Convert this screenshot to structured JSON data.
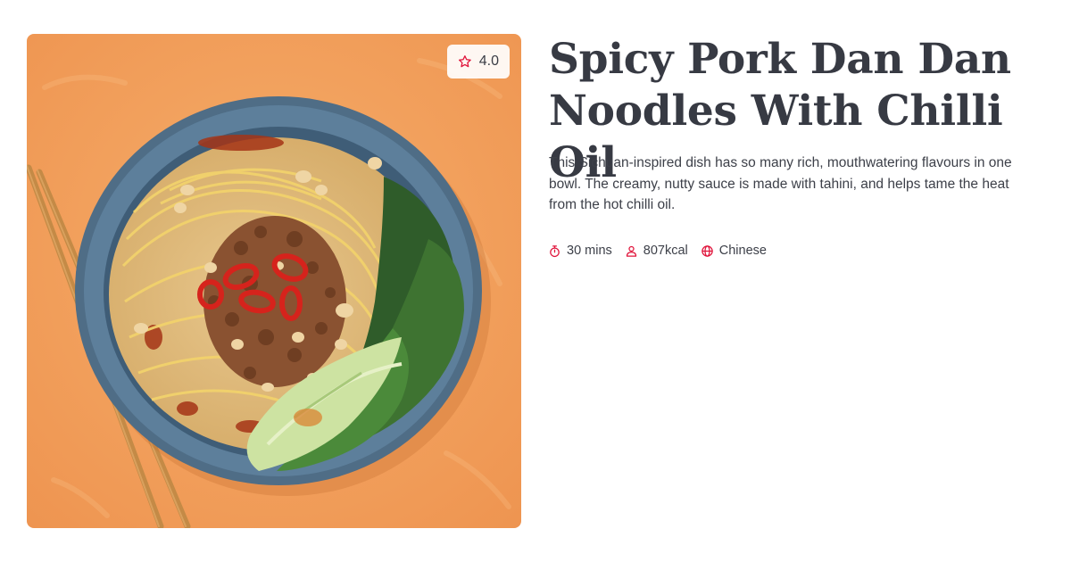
{
  "recipe": {
    "title": "Spicy Pork Dan Dan Noodles With Chilli Oil",
    "description": "This Sichuan-inspired dish has so many rich, mouthwatering flavours in one bowl. The creamy, nutty sauce is made with tahini, and helps tame the heat from the hot chilli oil.",
    "rating": "4.0",
    "meta": {
      "time": "30 mins",
      "calories": "807kcal",
      "cuisine": "Chinese"
    },
    "image_icon": "noodle-bowl-photo"
  },
  "icons": {
    "rating": "star-icon",
    "time": "stopwatch-icon",
    "calories": "person-icon",
    "cuisine": "globe-icon"
  },
  "colors": {
    "accent": "#e0133a",
    "title": "#373a43",
    "text": "#3d4049",
    "background": "#ffffff",
    "image_background": "#f2a15a"
  }
}
